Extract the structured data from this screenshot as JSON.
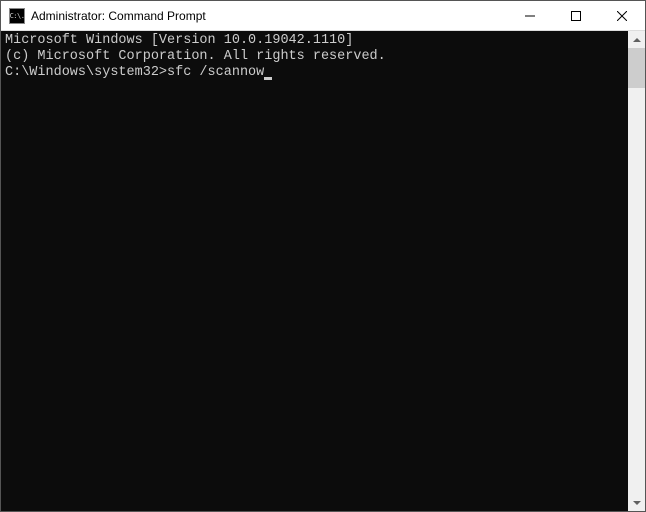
{
  "window": {
    "title": "Administrator: Command Prompt",
    "icon_label": "C:\\."
  },
  "terminal": {
    "lines": [
      "Microsoft Windows [Version 10.0.19042.1110]",
      "(c) Microsoft Corporation. All rights reserved.",
      ""
    ],
    "prompt": "C:\\Windows\\system32>",
    "command": "sfc /scannow"
  }
}
